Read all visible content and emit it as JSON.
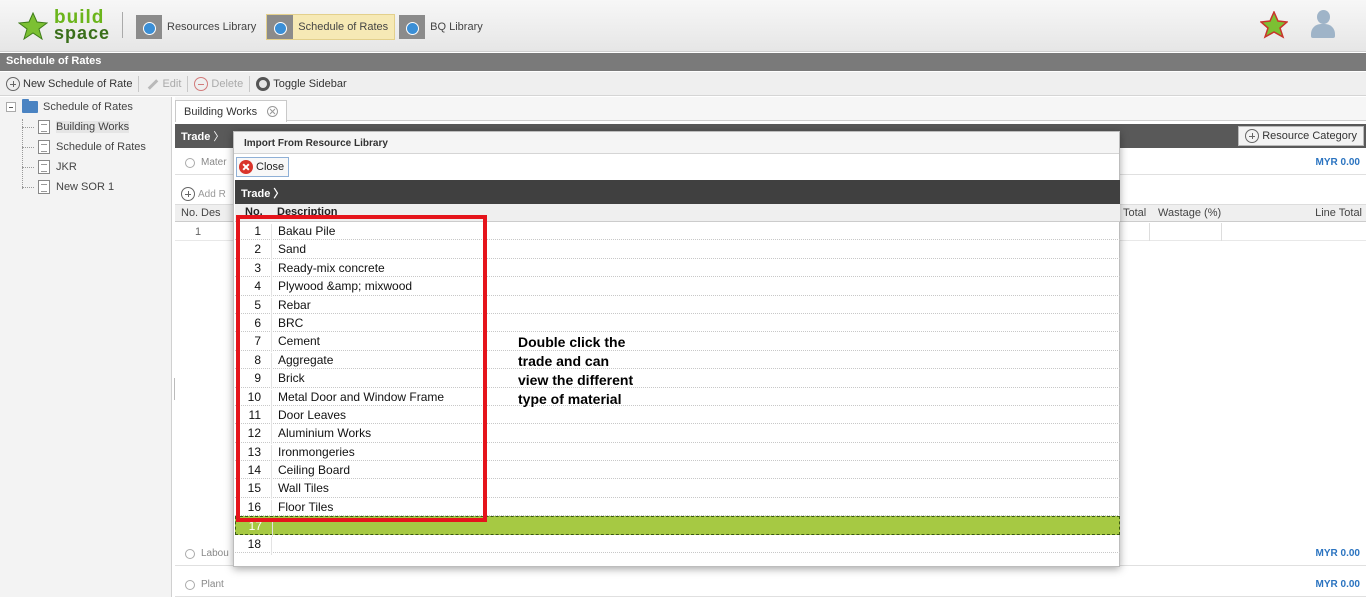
{
  "header": {
    "brand_top": "build",
    "brand_bottom": "space",
    "nav": [
      {
        "label": "Resources Library",
        "active": false
      },
      {
        "label": "Schedule of Rates",
        "active": true
      },
      {
        "label": "BQ Library",
        "active": false
      }
    ]
  },
  "titlebar": {
    "title": "Schedule of Rates"
  },
  "toolbar": {
    "new_label": "New Schedule of Rate",
    "edit_label": "Edit",
    "delete_label": "Delete",
    "toggle_label": "Toggle Sidebar"
  },
  "sidebar": {
    "root": "Schedule of Rates",
    "items": [
      "Building Works",
      "Schedule of Rates",
      "JKR",
      "New SOR 1"
    ]
  },
  "main": {
    "tab_label": "Building Works",
    "crumb": "Trade",
    "resource_category_label": "Resource Category",
    "groups": [
      {
        "label": "Mater",
        "total": "MYR 0.00"
      },
      {
        "label": "Labou",
        "total": "MYR 0.00"
      },
      {
        "label": "Plant",
        "total": "MYR 0.00"
      }
    ],
    "add_label": "Add R",
    "columns": {
      "no": "No.",
      "desc": "Des",
      "total": "Total",
      "wastage": "Wastage (%)",
      "line_total": "Line Total"
    },
    "first_row_no": "1"
  },
  "dialog": {
    "title": "Import From Resource Library",
    "close_label": "Close",
    "crumb": "Trade",
    "col_no": "No.",
    "col_desc": "Description",
    "rows": [
      {
        "no": "1",
        "desc": "Bakau Pile"
      },
      {
        "no": "2",
        "desc": "Sand"
      },
      {
        "no": "3",
        "desc": "Ready-mix concrete"
      },
      {
        "no": "4",
        "desc": "Plywood &amp; mixwood"
      },
      {
        "no": "5",
        "desc": "Rebar"
      },
      {
        "no": "6",
        "desc": "BRC"
      },
      {
        "no": "7",
        "desc": "Cement"
      },
      {
        "no": "8",
        "desc": "Aggregate"
      },
      {
        "no": "9",
        "desc": "Brick"
      },
      {
        "no": "10",
        "desc": "Metal Door and Window Frame"
      },
      {
        "no": "11",
        "desc": "Door Leaves"
      },
      {
        "no": "12",
        "desc": "Aluminium Works"
      },
      {
        "no": "13",
        "desc": "Ironmongeries"
      },
      {
        "no": "14",
        "desc": "Ceiling Board"
      },
      {
        "no": "15",
        "desc": "Wall Tiles"
      },
      {
        "no": "16",
        "desc": "Floor Tiles"
      },
      {
        "no": "17",
        "desc": ""
      },
      {
        "no": "18",
        "desc": ""
      }
    ],
    "selected_row": "17"
  },
  "annotation": {
    "line1": "Double click the",
    "line2": "trade and can",
    "line3": "view the different",
    "line4": "type of material"
  },
  "colors": {
    "accent_green": "#a6c943",
    "highlight_red": "#e5141b",
    "link_blue": "#2a73c0"
  }
}
